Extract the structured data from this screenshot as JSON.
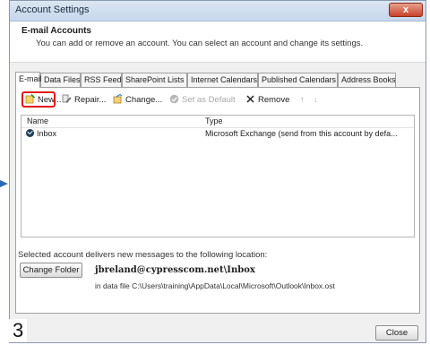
{
  "window": {
    "title": "Account Settings",
    "close_label": "x"
  },
  "header": {
    "title": "E-mail Accounts",
    "subtitle": "You can add or remove an account. You can select an account and change its settings."
  },
  "tabs": [
    {
      "label": "E-mail"
    },
    {
      "label": "Data Files"
    },
    {
      "label": "RSS Feeds"
    },
    {
      "label": "SharePoint Lists"
    },
    {
      "label": "Internet Calendars"
    },
    {
      "label": "Published Calendars"
    },
    {
      "label": "Address Books"
    }
  ],
  "toolbar": {
    "new": "New...",
    "repair": "Repair...",
    "change": "Change...",
    "set_default": "Set as Default",
    "remove": "Remove",
    "up": "↑",
    "down": "↓"
  },
  "list": {
    "columns": [
      "Name",
      "Type"
    ],
    "rows": [
      {
        "name": "Inbox",
        "type": "Microsoft Exchange (send from this account by defa..."
      }
    ]
  },
  "delivery": {
    "label": "Selected account delivers new messages to the following location:",
    "change_folder": "Change Folder",
    "account_path": "jbreland@cypresscom.net\\Inbox",
    "data_file": "in data file C:\\Users\\training\\AppData\\Local\\Microsoft\\Outlook\\Inbox.ost"
  },
  "footer": {
    "close": "Close"
  },
  "annotation": {
    "step": "3"
  },
  "colors": {
    "highlight": "#e01818",
    "arrow": "#2b6bb4",
    "titlebar": "#c6d6ec"
  }
}
